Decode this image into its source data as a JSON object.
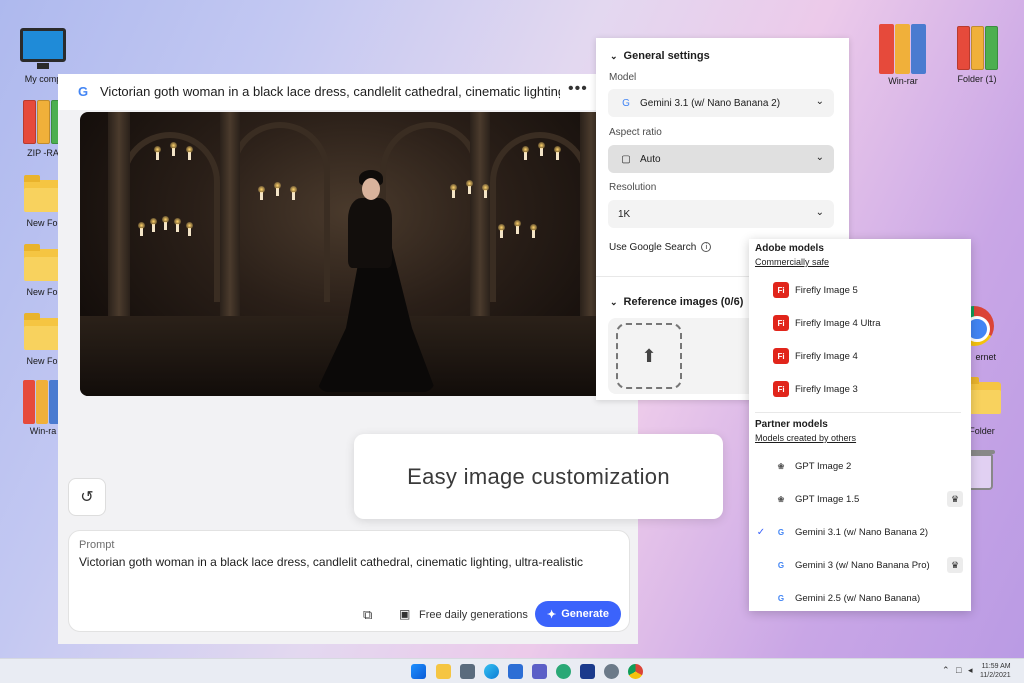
{
  "desktop": {
    "icons_left": [
      {
        "label": "My comp"
      },
      {
        "label": "ZIP -RA"
      },
      {
        "label": "New Fol"
      },
      {
        "label": "New Fol"
      },
      {
        "label": "New Fol"
      },
      {
        "label": "Win-ra"
      }
    ],
    "icons_right": [
      {
        "label": "Win-rar"
      },
      {
        "label": "Folder (1)"
      },
      {
        "label": "ernet"
      },
      {
        "label": "Folder"
      }
    ]
  },
  "app": {
    "title": "Victorian goth woman in a black lace dress, candlelit cathedral, cinematic lighting, ultra-re",
    "more": "•••",
    "prompt": {
      "label": "Prompt",
      "text": "Victorian goth woman in a black lace dress, candlelit cathedral, cinematic lighting, ultra-realistic"
    },
    "free_daily": "Free daily generations",
    "generate": "Generate"
  },
  "callout": "Easy image customization",
  "settings": {
    "general_title": "General settings",
    "model_label": "Model",
    "model_value": "Gemini 3.1 (w/ Nano Banana 2)",
    "aspect_label": "Aspect ratio",
    "aspect_value": "Auto",
    "resolution_label": "Resolution",
    "resolution_value": "1K",
    "google_search_label": "Use Google Search",
    "reference_title": "Reference images (0/6)"
  },
  "model_menu": {
    "adobe_title": "Adobe models",
    "adobe_sub": "Commercially safe",
    "adobe_items": [
      {
        "label": "Firefly Image 5"
      },
      {
        "label": "Firefly Image 4 Ultra"
      },
      {
        "label": "Firefly Image 4"
      },
      {
        "label": "Firefly Image 3"
      }
    ],
    "partner_title": "Partner models",
    "partner_sub": "Models created by others",
    "partner_items": [
      {
        "label": "GPT Image 2",
        "icon": "openai-icon",
        "crown": false,
        "selected": false
      },
      {
        "label": "GPT Image 1.5",
        "icon": "openai-icon",
        "crown": true,
        "selected": false
      },
      {
        "label": "Gemini 3.1 (w/ Nano Banana 2)",
        "icon": "google-icon",
        "crown": false,
        "selected": true
      },
      {
        "label": "Gemini 3 (w/ Nano Banana Pro)",
        "icon": "google-icon",
        "crown": true,
        "selected": false
      },
      {
        "label": "Gemini 2.5 (w/ Nano Banana)",
        "icon": "google-icon",
        "crown": false,
        "selected": false
      }
    ]
  },
  "taskbar": {
    "time": "11:59 AM",
    "date": "11/2/2021"
  },
  "colors": {
    "accent": "#3b63fb",
    "firefly": "#e1251b"
  }
}
